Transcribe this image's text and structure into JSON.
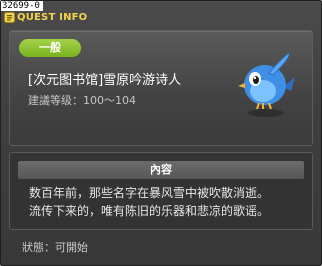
{
  "window": {
    "quest_id": "32699-0",
    "title": "QUEST INFO"
  },
  "quest": {
    "category": "一般",
    "name": "[次元图书馆]雪原吟游诗人",
    "level": "建議等级：100～104"
  },
  "content": {
    "header": "內容",
    "lines": [
      "数百年前，那些名字在暴风雪中被吹散消逝。",
      "流传下来的，唯有陈旧的乐器和悲凉的歌谣。"
    ]
  },
  "status": "狀態：可開始",
  "icons": {
    "title": "quest-info-icon",
    "mascot": "blue-bird-icon"
  },
  "colors": {
    "title": "#f3d34a",
    "badge": "#8cc234",
    "bird": "#3f8fe6"
  }
}
